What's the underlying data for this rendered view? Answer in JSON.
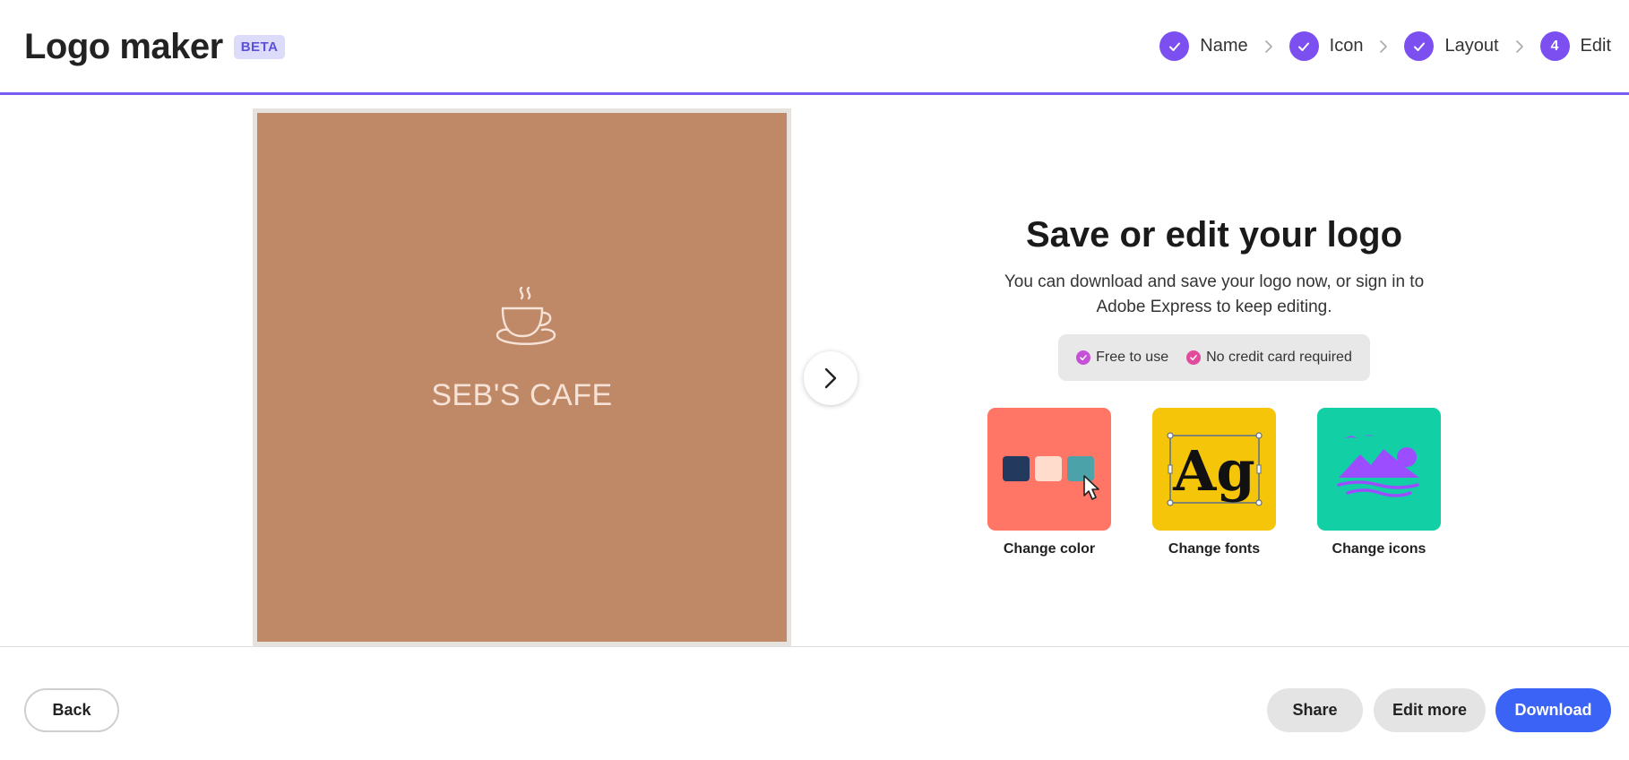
{
  "header": {
    "title": "Logo maker",
    "badge": "BETA",
    "steps": [
      {
        "label": "Name",
        "state": "done",
        "icon": "check-icon"
      },
      {
        "label": "Icon",
        "state": "done",
        "icon": "check-icon"
      },
      {
        "label": "Layout",
        "state": "done",
        "icon": "check-icon"
      },
      {
        "label": "Edit",
        "state": "current",
        "number": "4"
      }
    ],
    "accent_color": "#7b5cf0"
  },
  "preview": {
    "logo_text": "SEB'S CAFE",
    "icon": "coffee-cup-icon",
    "background_color": "#bf8968",
    "next_icon": "chevron-right-icon"
  },
  "panel": {
    "title": "Save or edit your logo",
    "subtitle": "You can download and save your logo now, or sign in to Adobe Express to keep editing.",
    "perks": [
      "Free to use",
      "No credit card required"
    ],
    "options": [
      {
        "label": "Change color",
        "icon": "color-swatches-icon",
        "tile_color": "#ff7566"
      },
      {
        "label": "Change fonts",
        "icon": "font-ag-icon",
        "tile_color": "#f5c50a"
      },
      {
        "label": "Change icons",
        "icon": "landscape-icon",
        "tile_color": "#12cfa6"
      }
    ]
  },
  "footer": {
    "back_label": "Back",
    "share_label": "Share",
    "edit_more_label": "Edit more",
    "download_label": "Download",
    "download_color": "#3b63f6"
  }
}
